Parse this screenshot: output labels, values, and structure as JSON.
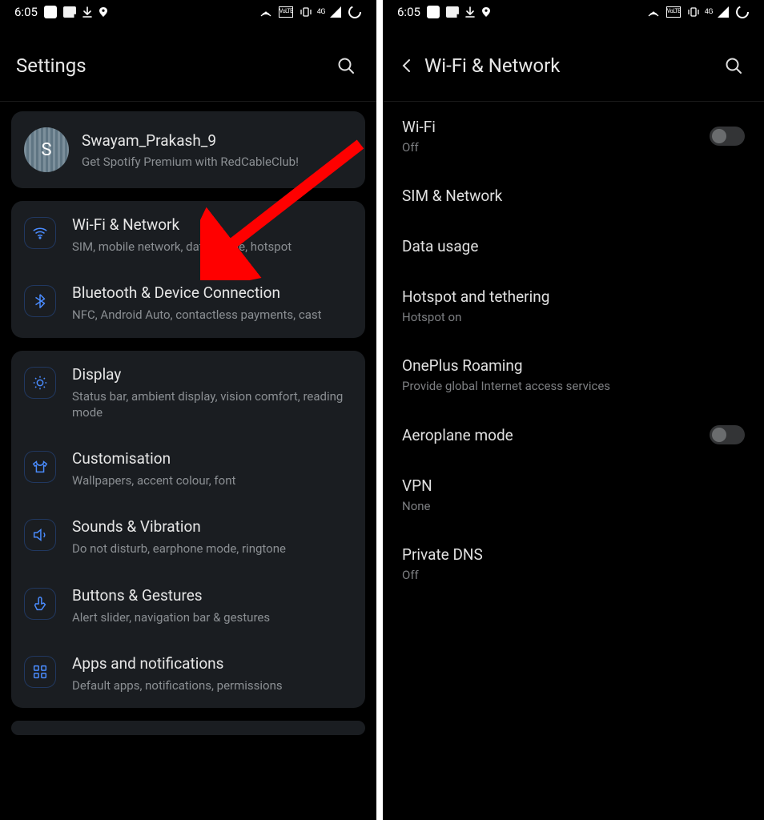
{
  "status": {
    "time": "6:05",
    "net_label": "4G",
    "lte_box": "VoLTE"
  },
  "left": {
    "header": {
      "title": "Settings"
    },
    "account": {
      "initial": "S",
      "name": "Swayam_Prakash_9",
      "sub": "Get Spotify Premium with RedCableClub!"
    },
    "group1": [
      {
        "icon": "wifi",
        "title": "Wi-Fi & Network",
        "sub": "SIM, mobile network, data usage, hotspot"
      },
      {
        "icon": "bluetooth",
        "title": "Bluetooth & Device Connection",
        "sub": "NFC, Android Auto, contactless payments, cast"
      }
    ],
    "group2": [
      {
        "icon": "display",
        "title": "Display",
        "sub": "Status bar, ambient display, vision comfort, reading mode"
      },
      {
        "icon": "shirt",
        "title": "Customisation",
        "sub": "Wallpapers, accent colour, font"
      },
      {
        "icon": "sound",
        "title": "Sounds & Vibration",
        "sub": "Do not disturb, earphone mode, ringtone"
      },
      {
        "icon": "gesture",
        "title": "Buttons & Gestures",
        "sub": "Alert slider, navigation bar & gestures"
      },
      {
        "icon": "apps",
        "title": "Apps and notifications",
        "sub": "Default apps, notifications, permissions"
      }
    ]
  },
  "right": {
    "header": {
      "title": "Wi-Fi & Network"
    },
    "rows": [
      {
        "title": "Wi-Fi",
        "sub": "Off",
        "toggle": true
      },
      {
        "title": "SIM & Network",
        "sub": ""
      },
      {
        "title": "Data usage",
        "sub": ""
      },
      {
        "title": "Hotspot and tethering",
        "sub": "Hotspot on"
      },
      {
        "title": "OnePlus Roaming",
        "sub": "Provide global Internet access services"
      },
      {
        "title": "Aeroplane mode",
        "sub": "",
        "toggle": true
      },
      {
        "title": "VPN",
        "sub": "None"
      },
      {
        "title": "Private DNS",
        "sub": "Off"
      }
    ]
  }
}
